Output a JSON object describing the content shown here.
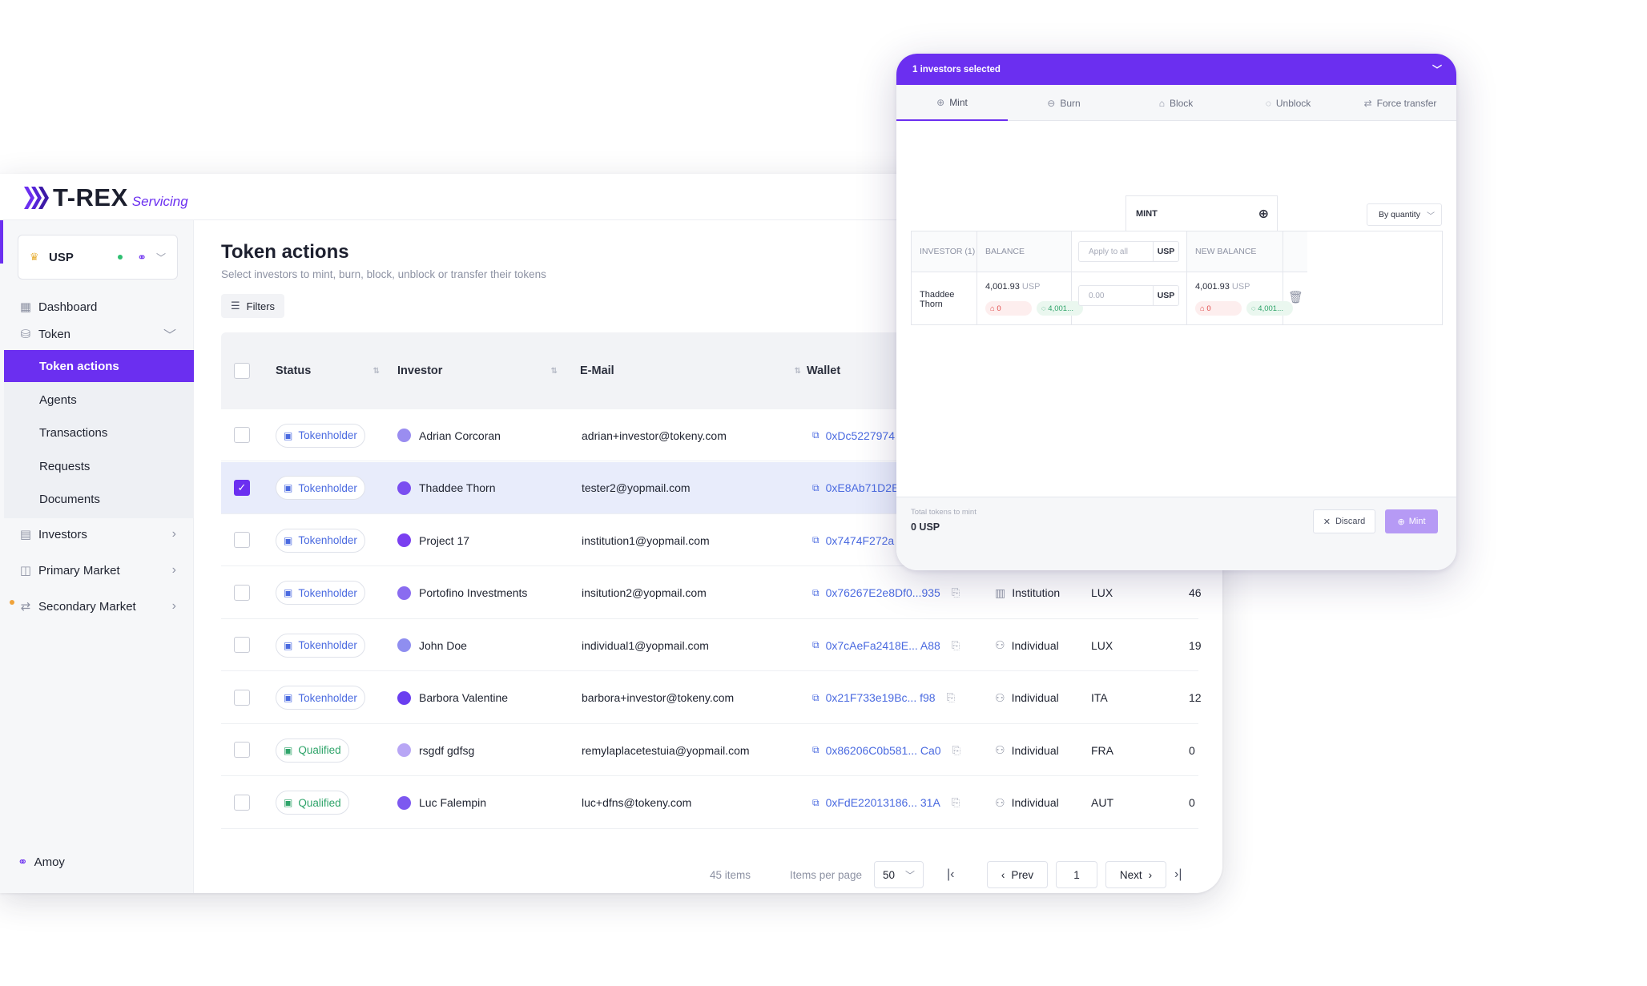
{
  "brand": {
    "name": "T-REX",
    "sub": "Servicing"
  },
  "network": {
    "label": "USP"
  },
  "nav": {
    "dashboard": "Dashboard",
    "token": "Token",
    "token_sub": [
      "Token actions",
      "Agents",
      "Transactions",
      "Requests",
      "Documents"
    ],
    "investors": "Investors",
    "primary_market": "Primary Market",
    "secondary_market": "Secondary Market",
    "bottom": "Amoy"
  },
  "page": {
    "title": "Token actions",
    "subtitle": "Select investors to mint, burn, block, unblock or transfer their tokens",
    "filters": "Filters"
  },
  "table": {
    "headers": {
      "status": "Status",
      "investor": "Investor",
      "email": "E-Mail",
      "wallet": "Wallet"
    },
    "rows": [
      {
        "status": "Tokenholder",
        "status_kind": "blue",
        "investor": "Adrian Corcoran",
        "email": "adrian+investor@tokeny.com",
        "wallet": "0xDc5227974",
        "type": "",
        "country": "",
        "value": "",
        "selected": false,
        "avatar": "#9a8df0"
      },
      {
        "status": "Tokenholder",
        "status_kind": "blue",
        "investor": "Thaddee Thorn",
        "email": "tester2@yopmail.com",
        "wallet": "0xE8Ab71D2E",
        "type": "",
        "country": "",
        "value": "",
        "selected": true,
        "avatar": "#7a4ef0"
      },
      {
        "status": "Tokenholder",
        "status_kind": "blue",
        "investor": "Project 17",
        "email": "institution1@yopmail.com",
        "wallet": "0x7474F272a",
        "type": "",
        "country": "",
        "value": "",
        "selected": false,
        "avatar": "#7a3ff0"
      },
      {
        "status": "Tokenholder",
        "status_kind": "blue",
        "investor": "Portofino Investments",
        "email": "insitution2@yopmail.com",
        "wallet": "0x76267E2e8Df0...935",
        "type": "Institution",
        "country": "LUX",
        "value": "46",
        "selected": false,
        "avatar": "#8a6cf0"
      },
      {
        "status": "Tokenholder",
        "status_kind": "blue",
        "investor": "John Doe",
        "email": "individual1@yopmail.com",
        "wallet": "0x7cAeFa2418E... A88",
        "type": "Individual",
        "country": "LUX",
        "value": "19",
        "selected": false,
        "avatar": "#8f8ef0"
      },
      {
        "status": "Tokenholder",
        "status_kind": "blue",
        "investor": "Barbora Valentine",
        "email": "barbora+investor@tokeny.com",
        "wallet": "0x21F733e19Bc... f98",
        "type": "Individual",
        "country": "ITA",
        "value": "12",
        "selected": false,
        "avatar": "#6a3ef0"
      },
      {
        "status": "Qualified",
        "status_kind": "green",
        "investor": "rsgdf gdfsg",
        "email": "remylaplacetestuia@yopmail.com",
        "wallet": "0x86206C0b581... Ca0",
        "type": "Individual",
        "country": "FRA",
        "value": "0",
        "selected": false,
        "avatar": "#b8a6f5"
      },
      {
        "status": "Qualified",
        "status_kind": "green",
        "investor": "Luc Falempin",
        "email": "luc+dfns@tokeny.com",
        "wallet": "0xFdE22013186... 31A",
        "type": "Individual",
        "country": "AUT",
        "value": "0",
        "selected": false,
        "avatar": "#7d58f0"
      }
    ]
  },
  "pagination": {
    "items": "45 items",
    "per_page_label": "Items per page",
    "per_page": "50",
    "prev": "Prev",
    "page": "1",
    "next": "Next"
  },
  "modal": {
    "header": "1 investors selected",
    "tabs": [
      "Mint",
      "Burn",
      "Block",
      "Unblock",
      "Force transfer"
    ],
    "mint_col": "MINT",
    "mode": "By quantity",
    "cols": {
      "investor": "INVESTOR (1)",
      "balance": "BALANCE",
      "new_balance": "NEW BALANCE"
    },
    "apply_all_placeholder": "Apply to all",
    "unit": "USP",
    "row": {
      "investor": "Thaddee Thorn",
      "balance": "4,001.93",
      "blocked": "0",
      "free": "4,001...",
      "input_placeholder": "0.00",
      "new_balance": "4,001.93",
      "new_blocked": "0",
      "new_free": "4,001..."
    },
    "total_label": "Total tokens to mint",
    "total_value": "0 USP",
    "discard": "Discard",
    "mint": "Mint"
  },
  "colors": {
    "accent": "#6b2ff0",
    "status_blue": "#4a6ae0",
    "status_green": "#2fa46a"
  }
}
